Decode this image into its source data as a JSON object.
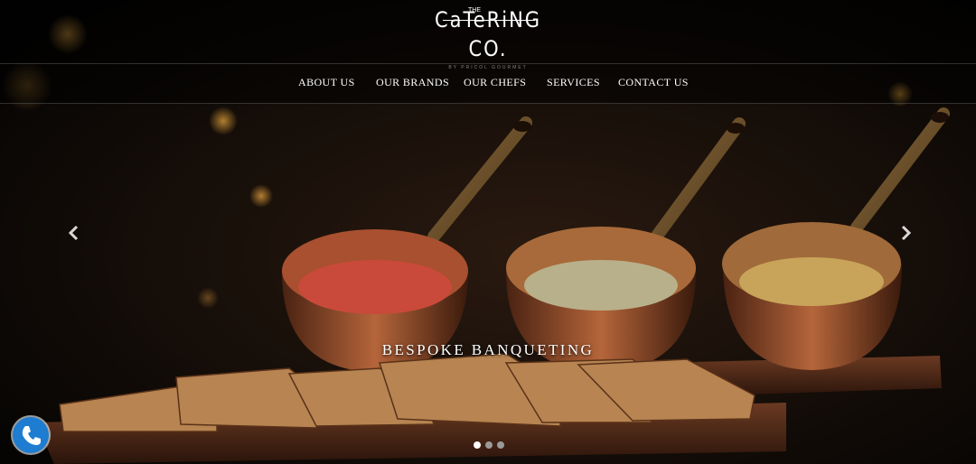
{
  "logo": {
    "the": "THE",
    "main": "CaTeRiNG CO.",
    "sub": "BY PRICOL GOURMET"
  },
  "nav": {
    "items": [
      {
        "label": "ABOUT US"
      },
      {
        "label": "OUR BRANDS"
      },
      {
        "label": "OUR CHEFS"
      },
      {
        "label": "SERVICES"
      },
      {
        "label": "CONTACT US"
      }
    ]
  },
  "slider": {
    "caption": "BESPOKE BANQUETING",
    "slide_count": 3,
    "active_slide": 1
  },
  "icons": {
    "prev": "chevron-left-icon",
    "next": "chevron-right-icon",
    "call": "phone-icon"
  },
  "colors": {
    "accent": "#1e7cd1",
    "copper": "#b5653a"
  }
}
